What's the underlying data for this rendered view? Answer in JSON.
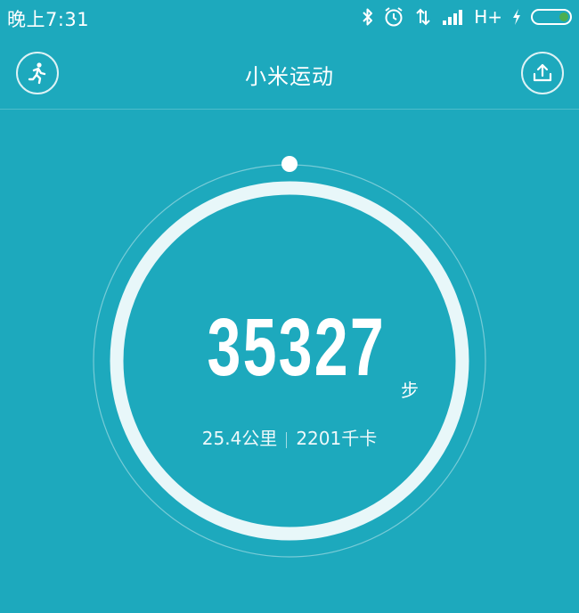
{
  "status_bar": {
    "time": "晚上7:31",
    "network": "H+",
    "icons": [
      "bluetooth-icon",
      "alarm-icon",
      "data-arrows-icon",
      "signal-icon",
      "charging-icon",
      "battery-icon"
    ],
    "battery_color": "#4caf50"
  },
  "app_bar": {
    "title": "小米运动",
    "left_icon": "runner-icon",
    "right_icon": "share-upload-icon"
  },
  "steps": {
    "count": "35327",
    "unit": "步",
    "distance": "25.4公里",
    "calories": "2201千卡"
  },
  "theme": {
    "background": "#1da9bd",
    "ring": "#e8f7f9",
    "outer_ring": "rgba(255,255,255,0.4)"
  }
}
